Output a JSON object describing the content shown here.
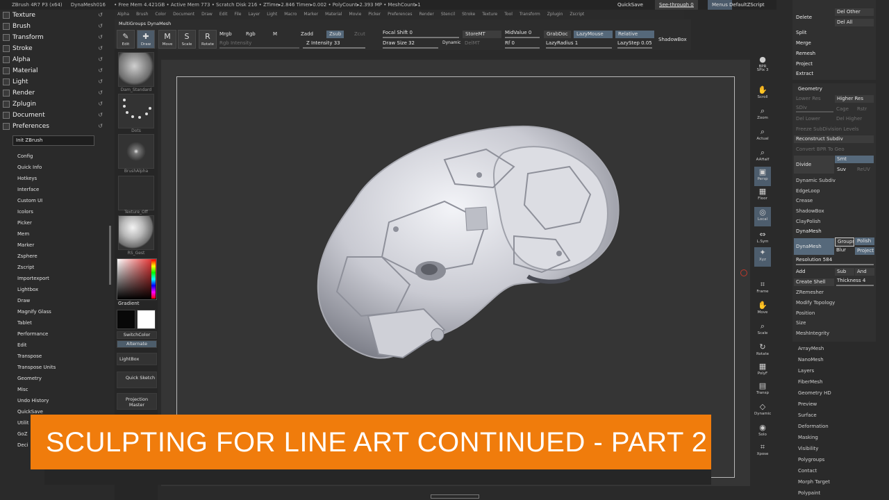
{
  "titlebar": {
    "segments": [
      "ZBrush 4R7 P3 (x64)",
      "DynaMesh016",
      "• Free Mem 4.421GB • Active Mem 773 • Scratch Disk 216 • ZTime▸2.846 Timer▸0.002 • PolyCount▸2.393 MP • MeshCount▸1"
    ],
    "quicksave": "QuickSave",
    "seethrough": "See-through  0",
    "menus": "Menus",
    "defaultzscript": "DefaultZScript"
  },
  "menubar": [
    "Alpha",
    "Brush",
    "Color",
    "Document",
    "Draw",
    "Edit",
    "File",
    "Layer",
    "Light",
    "Macro",
    "Marker",
    "Material",
    "Movie",
    "Picker",
    "Preferences",
    "Render",
    "Stencil",
    "Stroke",
    "Texture",
    "Tool",
    "Transform",
    "Zplugin",
    "Zscript"
  ],
  "left_palettes": [
    "Texture",
    "Brush",
    "Transform",
    "Stroke",
    "Alpha",
    "Material",
    "Light",
    "Render",
    "Zplugin",
    "Document",
    "Preferences"
  ],
  "init_zbrush": "Init ZBrush",
  "preferences_items": [
    "Config",
    "Quick Info",
    "Hotkeys",
    "Interface",
    "Custom UI",
    "Icolors",
    "Picker",
    "Mem",
    "Marker",
    "Zsphere",
    "Zscript",
    "Importexport",
    "Lightbox",
    "Draw",
    "Magnify Glass",
    "Tablet",
    "Performance",
    "Edit",
    "Transpose",
    "Transpose Units",
    "Geometry",
    "Misc",
    "Undo History",
    "QuickSave",
    "Utilit",
    "GoZ",
    "Deci"
  ],
  "toolcol": {
    "brush": "Dam_Standard",
    "stroke": "Dots",
    "alpha": "BrushAlpha",
    "texture": "Texture_Off",
    "material": "RS_Gest",
    "gradient": "Gradient",
    "switchcolor": "SwitchColor",
    "alternate": "Alternate",
    "lightbox": "LightBox",
    "quicksketch": "Quick Sketch",
    "projectionmaster": "Projection Master"
  },
  "shelf": {
    "title": "MultiGroups DynaMesh",
    "modes": [
      {
        "label": "Edit",
        "glyph": "✎"
      },
      {
        "label": "Draw",
        "glyph": "✚"
      },
      {
        "label": "Move",
        "glyph": "M"
      },
      {
        "label": "Scale",
        "glyph": "S"
      },
      {
        "label": "Rotate",
        "glyph": "R"
      }
    ],
    "mrgb": "Mrgb",
    "rgb": "Rgb",
    "m": "M",
    "rgb_intensity": "Rgb Intensity",
    "zadd": "Zadd",
    "zsub": "Zsub",
    "zcut": "Zcut",
    "z_intensity": "Z Intensity 33",
    "focal_shift": "Focal Shift 0",
    "draw_size": "Draw Size 32",
    "dynamic": "Dynamic",
    "storemt": "StoreMT",
    "delmt": "DelMT",
    "midvalue": "MidValue 0",
    "rf": "Rf 0",
    "grabdoc": "GrabDoc",
    "lazymouse": "LazyMouse",
    "lazyradius": "LazyRadius 1",
    "relative": "Relative",
    "lazystep": "LazyStep 0.05",
    "shadowbox": "ShadowBox"
  },
  "right_icons": [
    {
      "label": "BPR",
      "glyph": "●"
    },
    {
      "label": "SPix 3",
      "glyph": ""
    },
    {
      "label": "Scroll",
      "glyph": "✋"
    },
    {
      "label": "Zoom",
      "glyph": "⌕"
    },
    {
      "label": "Actual",
      "glyph": "⌕"
    },
    {
      "label": "AAHalf",
      "glyph": "⌕"
    },
    {
      "label": "Persp",
      "glyph": "▣"
    },
    {
      "label": "Floor",
      "glyph": "▦"
    },
    {
      "label": "Local",
      "glyph": "◎"
    },
    {
      "label": "L.Sym",
      "glyph": "⇔"
    },
    {
      "label": "Xyz",
      "glyph": "✦"
    },
    {
      "label": "Frame",
      "glyph": "⌗"
    },
    {
      "label": "Move",
      "glyph": "✋"
    },
    {
      "label": "Scale",
      "glyph": "⌕"
    },
    {
      "label": "Rotate",
      "glyph": "↻"
    },
    {
      "label": "PolyF",
      "glyph": "▦"
    },
    {
      "label": "Transp",
      "glyph": "▤"
    },
    {
      "label": "Dynamic",
      "glyph": "◇"
    },
    {
      "label": "Solo",
      "glyph": "◉"
    },
    {
      "label": "Xpose",
      "glyph": "⌗"
    }
  ],
  "right_top": {
    "delete": "Delete",
    "del_other": "Del Other",
    "del_all": "Del All",
    "split": "Split",
    "merge": "Merge",
    "remesh": "Remesh",
    "project": "Project",
    "extract": "Extract"
  },
  "geometry": {
    "title": "Geometry",
    "lower_res": "Lower Res",
    "higher_res": "Higher Res",
    "sdiv": "SDiv",
    "cage": "Cage",
    "rstr": "Rstr",
    "del_lower": "Del Lower",
    "del_higher": "Del Higher",
    "freeze": "Freeze SubDivision Levels",
    "reconstruct": "Reconstruct Subdiv",
    "convert": "Convert BPR To Geo",
    "divide": "Divide",
    "smt": "Smt",
    "suv": "Suv",
    "reuv": "ReUV",
    "dynamic_subdiv": "Dynamic Subdiv",
    "edgeloop": "EdgeLoop",
    "crease": "Crease",
    "shadowbox": "ShadowBox",
    "claypolish": "ClayPolish",
    "dynamesh_header": "DynaMesh",
    "dynamesh_btn": "DynaMesh",
    "groups": "Groups",
    "polish": "Polish",
    "blur": "Blur",
    "project": "Project",
    "resolution": "Resolution 584",
    "add": "Add",
    "sub": "Sub",
    "and": "And",
    "create_shell": "Create Shell",
    "thickness": "Thickness 4",
    "zremesher": "ZRemesher",
    "modify_topology": "Modify Topology",
    "position": "Position",
    "size": "Size",
    "meshintegrity": "MeshIntegrity"
  },
  "tool_subpalettes": [
    "ArrayMesh",
    "NanoMesh",
    "Layers",
    "FiberMesh",
    "Geometry HD",
    "Preview",
    "Surface",
    "Deformation",
    "Masking",
    "Visibility",
    "Polygroups",
    "Contact",
    "Morph Target",
    "Polypaint"
  ],
  "banner": "SCULPTING FOR LINE ART CONTINUED - PART 2"
}
